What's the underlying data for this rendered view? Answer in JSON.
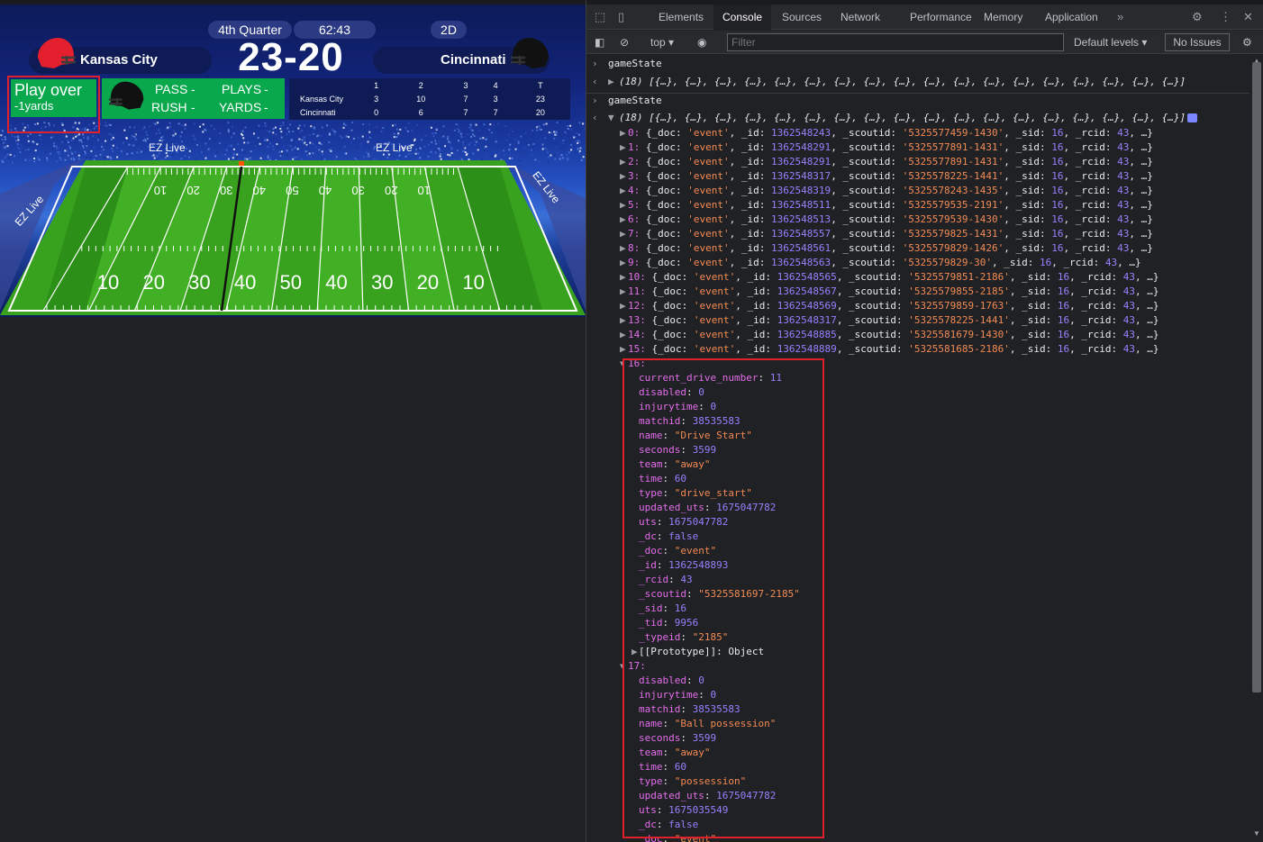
{
  "game": {
    "quarter": "4th Quarter",
    "clock": "62:43",
    "down": "2D",
    "home_team": "Kansas City",
    "away_team": "Cincinnati",
    "score": "23-20",
    "home_color": "#e4202e",
    "away_color": "#111111",
    "play_title": "Play over",
    "play_sub": "-1yards",
    "stats": {
      "pass_label": "PASS",
      "pass_value": "-",
      "rush_label": "RUSH",
      "rush_value": "-",
      "plays_label": "PLAYS",
      "plays_value": "-",
      "yards_label": "YARDS",
      "yards_value": "-"
    },
    "box_score": {
      "headers": [
        "1",
        "2",
        "3",
        "4",
        "T"
      ],
      "rows": [
        {
          "team": "Kansas City",
          "q": [
            "3",
            "10",
            "7",
            "3",
            "23"
          ]
        },
        {
          "team": "Cincinnati",
          "q": [
            "0",
            "6",
            "7",
            "7",
            "20"
          ]
        }
      ]
    },
    "banners": [
      "EZ Live",
      "EZ Live",
      "EZ Live",
      "EZ Live"
    ],
    "yard_numbers": [
      "10",
      "20",
      "30",
      "40",
      "50",
      "40",
      "30",
      "20",
      "10"
    ]
  },
  "devtools": {
    "tabs": [
      "Elements",
      "Console",
      "Sources",
      "Network",
      "Performance",
      "Memory",
      "Application"
    ],
    "active_tab": "Console",
    "context": "top",
    "filter_placeholder": "Filter",
    "levels": "Default levels",
    "issues": "No Issues",
    "cmd1": "gameState",
    "result1": "(18) [{…}, {…}, {…}, {…}, {…}, {…}, {…}, {…}, {…}, {…}, {…}, {…}, {…}, {…}, {…}, {…}, {…}, {…}]",
    "cmd2": "gameState",
    "result2": "(18) [{…}, {…}, {…}, {…}, {…}, {…}, {…}, {…}, {…}, {…}, {…}, {…}, {…}, {…}, {…}, {…}, {…}, {…}]",
    "events": [
      {
        "i": "0",
        "id": "1362548243",
        "scout": "5325577459-1430"
      },
      {
        "i": "1",
        "id": "1362548291",
        "scout": "5325577891-1431"
      },
      {
        "i": "2",
        "id": "1362548291",
        "scout": "5325577891-1431"
      },
      {
        "i": "3",
        "id": "1362548317",
        "scout": "5325578225-1441"
      },
      {
        "i": "4",
        "id": "1362548319",
        "scout": "5325578243-1435"
      },
      {
        "i": "5",
        "id": "1362548511",
        "scout": "5325579535-2191"
      },
      {
        "i": "6",
        "id": "1362548513",
        "scout": "5325579539-1430"
      },
      {
        "i": "7",
        "id": "1362548557",
        "scout": "5325579825-1431"
      },
      {
        "i": "8",
        "id": "1362548561",
        "scout": "5325579829-1426"
      },
      {
        "i": "9",
        "id": "1362548563",
        "scout": "5325579829-30"
      },
      {
        "i": "10",
        "id": "1362548565",
        "scout": "5325579851-2186"
      },
      {
        "i": "11",
        "id": "1362548567",
        "scout": "5325579855-2185"
      },
      {
        "i": "12",
        "id": "1362548569",
        "scout": "5325579859-1763"
      },
      {
        "i": "13",
        "id": "1362548317",
        "scout": "5325578225-1441"
      },
      {
        "i": "14",
        "id": "1362548885",
        "scout": "5325581679-1430"
      },
      {
        "i": "15",
        "id": "1362548889",
        "scout": "5325581685-2186"
      }
    ],
    "obj16_index": "16:",
    "obj16": [
      {
        "k": "current_drive_number",
        "v": "11",
        "t": "num"
      },
      {
        "k": "disabled",
        "v": "0",
        "t": "num"
      },
      {
        "k": "injurytime",
        "v": "0",
        "t": "num"
      },
      {
        "k": "matchid",
        "v": "38535583",
        "t": "num"
      },
      {
        "k": "name",
        "v": "\"Drive Start\"",
        "t": "str"
      },
      {
        "k": "seconds",
        "v": "3599",
        "t": "num"
      },
      {
        "k": "team",
        "v": "\"away\"",
        "t": "str"
      },
      {
        "k": "time",
        "v": "60",
        "t": "num"
      },
      {
        "k": "type",
        "v": "\"drive_start\"",
        "t": "str"
      },
      {
        "k": "updated_uts",
        "v": "1675047782",
        "t": "num"
      },
      {
        "k": "uts",
        "v": "1675047782",
        "t": "num"
      },
      {
        "k": "_dc",
        "v": "false",
        "t": "num"
      },
      {
        "k": "_doc",
        "v": "\"event\"",
        "t": "str"
      },
      {
        "k": "_id",
        "v": "1362548893",
        "t": "num"
      },
      {
        "k": "_rcid",
        "v": "43",
        "t": "num"
      },
      {
        "k": "_scoutid",
        "v": "\"5325581697-2185\"",
        "t": "str"
      },
      {
        "k": "_sid",
        "v": "16",
        "t": "num"
      },
      {
        "k": "_tid",
        "v": "9956",
        "t": "num"
      },
      {
        "k": "_typeid",
        "v": "\"2185\"",
        "t": "str"
      }
    ],
    "prototype": "[[Prototype]]: Object",
    "obj17_index": "17:",
    "obj17": [
      {
        "k": "disabled",
        "v": "0",
        "t": "num"
      },
      {
        "k": "injurytime",
        "v": "0",
        "t": "num"
      },
      {
        "k": "matchid",
        "v": "38535583",
        "t": "num"
      },
      {
        "k": "name",
        "v": "\"Ball possession\"",
        "t": "str"
      },
      {
        "k": "seconds",
        "v": "3599",
        "t": "num"
      },
      {
        "k": "team",
        "v": "\"away\"",
        "t": "str"
      },
      {
        "k": "time",
        "v": "60",
        "t": "num"
      },
      {
        "k": "type",
        "v": "\"possession\"",
        "t": "str"
      },
      {
        "k": "updated_uts",
        "v": "1675047782",
        "t": "num"
      },
      {
        "k": "uts",
        "v": "1675035549",
        "t": "num"
      },
      {
        "k": "_dc",
        "v": "false",
        "t": "num"
      },
      {
        "k": "_doc",
        "v": "\"event\"",
        "t": "str"
      }
    ]
  }
}
